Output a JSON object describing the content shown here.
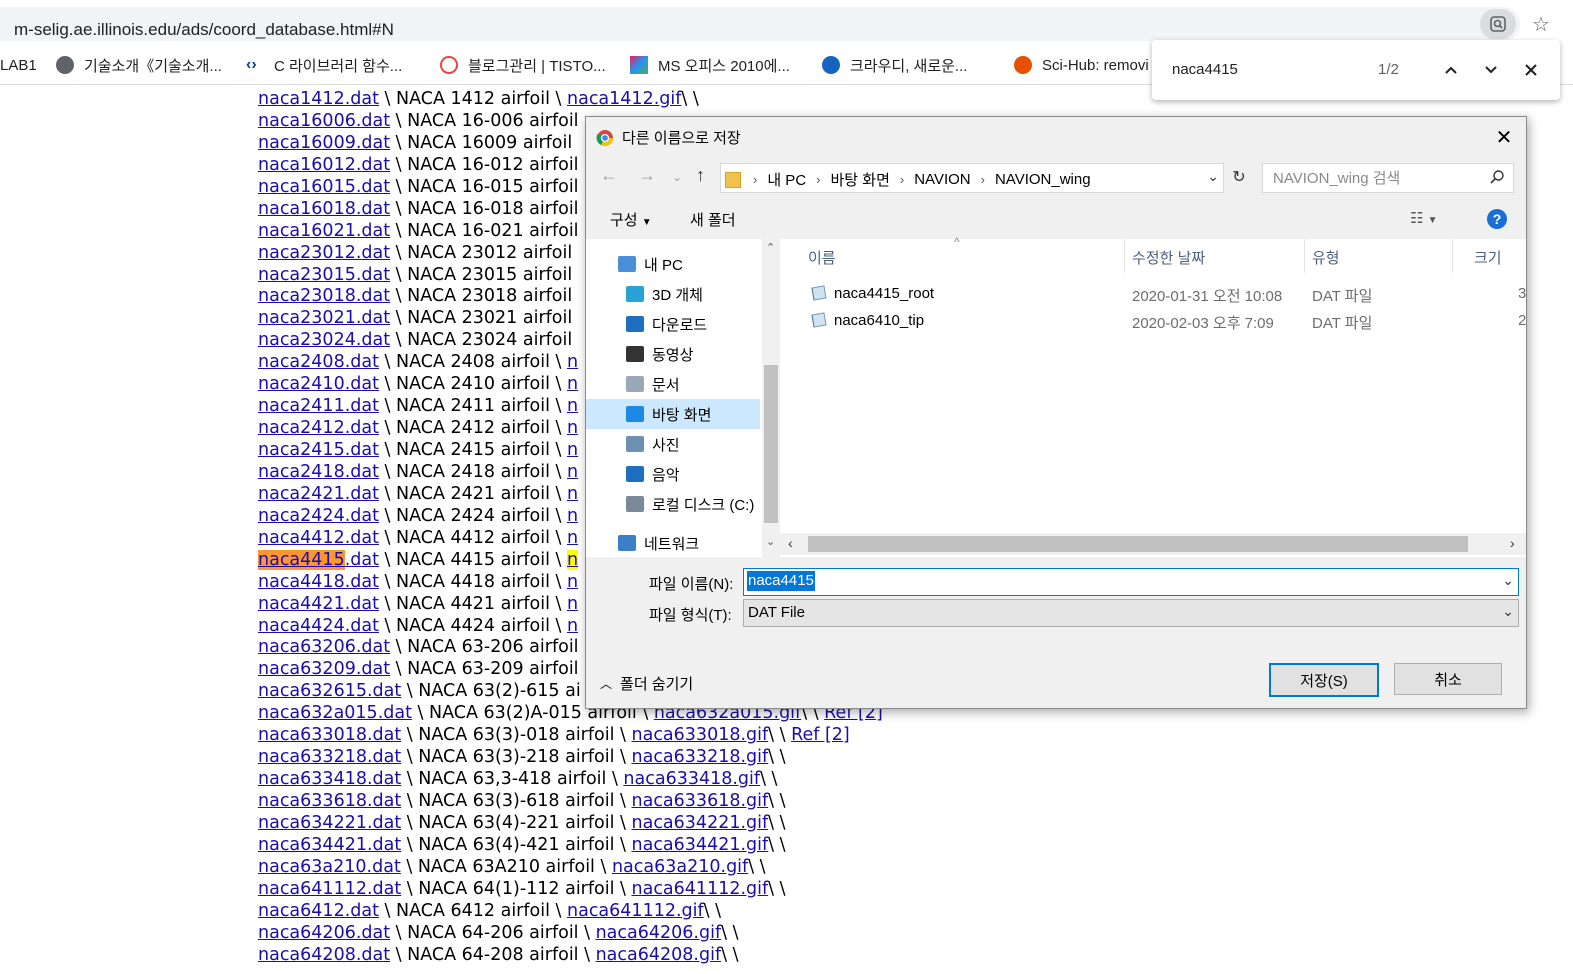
{
  "browser": {
    "url": "m-selig.ae.illinois.edu/ads/coord_database.html#N",
    "bookmarks": [
      {
        "label": "LAB1",
        "icon": "none"
      },
      {
        "label": "기술소개《기술소개...",
        "icon": "globe-icon"
      },
      {
        "label": "C 라이브러리 함수...",
        "icon": "code-icon"
      },
      {
        "label": "블로그관리 | TISTO...",
        "icon": "tistory-icon"
      },
      {
        "label": "MS 오피스 2010에...",
        "icon": "colorful-icon"
      },
      {
        "label": "크라우디, 새로운...",
        "icon": "medal-icon"
      },
      {
        "label": "Sci-Hub: removi",
        "icon": "scihub-icon"
      }
    ],
    "find": {
      "query": "naca4415",
      "count": "1/2"
    }
  },
  "page": {
    "rows": [
      {
        "dat": "naca1412.dat",
        "desc": " \\ NACA 1412 airfoil \\ ",
        "gif": "naca1412.gif",
        "tail": "\\ \\"
      },
      {
        "dat": "naca16006.dat",
        "desc": " \\ NACA 16-006 airfoil",
        "gif": "",
        "tail": ""
      },
      {
        "dat": "naca16009.dat",
        "desc": " \\ NACA 16009 airfoil",
        "gif": "",
        "tail": ""
      },
      {
        "dat": "naca16012.dat",
        "desc": " \\ NACA 16-012 airfoil",
        "gif": "",
        "tail": ""
      },
      {
        "dat": "naca16015.dat",
        "desc": " \\ NACA 16-015 airfoil",
        "gif": "",
        "tail": ""
      },
      {
        "dat": "naca16018.dat",
        "desc": " \\ NACA 16-018 airfoil",
        "gif": "",
        "tail": ""
      },
      {
        "dat": "naca16021.dat",
        "desc": " \\ NACA 16-021 airfoil",
        "gif": "",
        "tail": ""
      },
      {
        "dat": "naca23012.dat",
        "desc": " \\ NACA 23012 airfoil",
        "gif": "",
        "tail": ""
      },
      {
        "dat": "naca23015.dat",
        "desc": " \\ NACA 23015 airfoil",
        "gif": "",
        "tail": ""
      },
      {
        "dat": "naca23018.dat",
        "desc": " \\ NACA 23018 airfoil",
        "gif": "",
        "tail": ""
      },
      {
        "dat": "naca23021.dat",
        "desc": " \\ NACA 23021 airfoil",
        "gif": "",
        "tail": ""
      },
      {
        "dat": "naca23024.dat",
        "desc": " \\ NACA 23024 airfoil",
        "gif": "",
        "tail": ""
      },
      {
        "dat": "naca2408.dat",
        "desc": " \\ NACA 2408 airfoil \\ ",
        "gif": "n",
        "tail": ""
      },
      {
        "dat": "naca2410.dat",
        "desc": " \\ NACA 2410 airfoil \\ ",
        "gif": "n",
        "tail": ""
      },
      {
        "dat": "naca2411.dat",
        "desc": " \\ NACA 2411 airfoil \\ ",
        "gif": "n",
        "tail": ""
      },
      {
        "dat": "naca2412.dat",
        "desc": " \\ NACA 2412 airfoil \\ ",
        "gif": "n",
        "tail": ""
      },
      {
        "dat": "naca2415.dat",
        "desc": " \\ NACA 2415 airfoil \\ ",
        "gif": "n",
        "tail": ""
      },
      {
        "dat": "naca2418.dat",
        "desc": " \\ NACA 2418 airfoil \\ ",
        "gif": "n",
        "tail": ""
      },
      {
        "dat": "naca2421.dat",
        "desc": " \\ NACA 2421 airfoil \\ ",
        "gif": "n",
        "tail": ""
      },
      {
        "dat": "naca2424.dat",
        "desc": " \\ NACA 2424 airfoil \\ ",
        "gif": "n",
        "tail": ""
      },
      {
        "dat": "naca4412.dat",
        "desc": " \\ NACA 4412 airfoil \\ ",
        "gif": "n",
        "tail": ""
      },
      {
        "dat": "naca4415.dat",
        "desc": " \\ NACA 4415 airfoil \\ ",
        "gif": "n",
        "tail": "",
        "highlight": "current"
      },
      {
        "dat": "naca4418.dat",
        "desc": " \\ NACA 4418 airfoil \\ ",
        "gif": "n",
        "tail": ""
      },
      {
        "dat": "naca4421.dat",
        "desc": " \\ NACA 4421 airfoil \\ ",
        "gif": "n",
        "tail": ""
      },
      {
        "dat": "naca4424.dat",
        "desc": " \\ NACA 4424 airfoil \\ ",
        "gif": "n",
        "tail": ""
      },
      {
        "dat": "naca63206.dat",
        "desc": " \\ NACA 63-206 airfoil",
        "gif": "",
        "tail": ""
      },
      {
        "dat": "naca63209.dat",
        "desc": " \\ NACA 63-209 airfoil",
        "gif": "",
        "tail": ""
      },
      {
        "dat": "naca632615.dat",
        "desc": " \\ NACA 63(2)-615 ai",
        "gif": "",
        "tail": ""
      },
      {
        "dat": "naca632a015.dat",
        "desc": " \\ NACA 63(2)A-015 airfoil \\ ",
        "gif": "naca632a015.gif",
        "tail": "\\ \\ ",
        "ref": "Ref [2]"
      },
      {
        "dat": "naca633018.dat",
        "desc": " \\ NACA 63(3)-018 airfoil \\ ",
        "gif": "naca633018.gif",
        "tail": "\\ \\ ",
        "ref": "Ref [2]"
      },
      {
        "dat": "naca633218.dat",
        "desc": " \\ NACA 63(3)-218 airfoil \\ ",
        "gif": "naca633218.gif",
        "tail": "\\ \\"
      },
      {
        "dat": "naca633418.dat",
        "desc": " \\ NACA 63,3-418 airfoil \\ ",
        "gif": "naca633418.gif",
        "tail": "\\ \\"
      },
      {
        "dat": "naca633618.dat",
        "desc": " \\ NACA 63(3)-618 airfoil \\ ",
        "gif": "naca633618.gif",
        "tail": "\\ \\"
      },
      {
        "dat": "naca634221.dat",
        "desc": " \\ NACA 63(4)-221 airfoil \\ ",
        "gif": "naca634221.gif",
        "tail": "\\ \\"
      },
      {
        "dat": "naca634421.dat",
        "desc": " \\ NACA 63(4)-421 airfoil \\ ",
        "gif": "naca634421.gif",
        "tail": "\\ \\"
      },
      {
        "dat": "naca63a210.dat",
        "desc": " \\ NACA 63A210 airfoil \\ ",
        "gif": "naca63a210.gif",
        "tail": "\\ \\"
      },
      {
        "dat": "naca641112.dat",
        "desc": " \\ NACA 64(1)-112 airfoil \\ ",
        "gif": "naca641112.gif",
        "tail": "\\ \\"
      },
      {
        "dat": "naca6412.dat",
        "desc": " \\ NACA 6412 airfoil \\ ",
        "gif": "naca641112.gif",
        "tail": "\\ \\"
      },
      {
        "dat": "naca64206.dat",
        "desc": " \\ NACA 64-206 airfoil \\ ",
        "gif": "naca64206.gif",
        "tail": "\\ \\"
      },
      {
        "dat": "naca64208.dat",
        "desc": " \\ NACA 64-208 airfoil \\ ",
        "gif": "naca64208.gif",
        "tail": "\\ \\"
      }
    ]
  },
  "dialog": {
    "title": "다른 이름으로 저장",
    "path": [
      "내 PC",
      "바탕 화면",
      "NAVION",
      "NAVION_wing"
    ],
    "search_placeholder": "NAVION_wing 검색",
    "organize": "구성",
    "new_folder": "새 폴더",
    "nav": [
      {
        "label": "내 PC",
        "icon": "pc-icon"
      },
      {
        "label": "3D 개체",
        "icon": "3d-objects-icon"
      },
      {
        "label": "다운로드",
        "icon": "download-icon"
      },
      {
        "label": "동영상",
        "icon": "video-icon"
      },
      {
        "label": "문서",
        "icon": "document-icon"
      },
      {
        "label": "바탕 화면",
        "icon": "desktop-icon",
        "selected": true
      },
      {
        "label": "사진",
        "icon": "picture-icon"
      },
      {
        "label": "음악",
        "icon": "music-icon"
      },
      {
        "label": "로컬 디스크 (C:)",
        "icon": "disk-icon"
      },
      {
        "label": "네트워크",
        "icon": "network-icon"
      }
    ],
    "columns": {
      "name": "이름",
      "date": "수정한 날짜",
      "type": "유형",
      "size": "크기"
    },
    "files": [
      {
        "name": "naca4415_root",
        "date": "2020-01-31 오전 10:08",
        "type": "DAT 파일",
        "size": "3"
      },
      {
        "name": "naca6410_tip",
        "date": "2020-02-03 오후 7:09",
        "type": "DAT 파일",
        "size": "2"
      }
    ],
    "filename_label": "파일 이름(N):",
    "filename_value": "naca4415",
    "filetype_label": "파일 형식(T):",
    "filetype_value": "DAT File",
    "hide_folders": "폴더 숨기기",
    "save_label": "저장(S)",
    "cancel_label": "취소"
  }
}
